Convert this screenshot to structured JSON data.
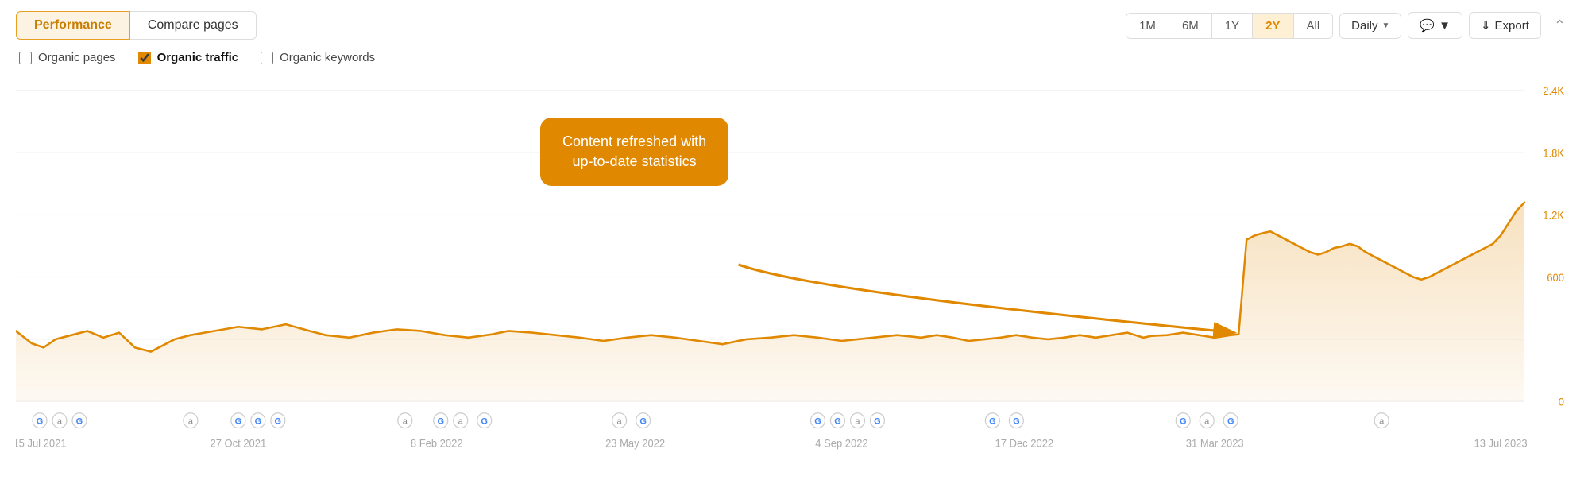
{
  "tabs": {
    "performance_label": "Performance",
    "compare_pages_label": "Compare pages"
  },
  "time_buttons": [
    "1M",
    "6M",
    "1Y",
    "2Y",
    "All"
  ],
  "active_time": "2Y",
  "daily_label": "Daily",
  "export_label": "Export",
  "checkboxes": [
    {
      "id": "organic-pages",
      "label": "Organic pages",
      "checked": false
    },
    {
      "id": "organic-traffic",
      "label": "Organic traffic",
      "checked": true
    },
    {
      "id": "organic-keywords",
      "label": "Organic keywords",
      "checked": false
    }
  ],
  "tooltip": {
    "line1": "Content refreshed with",
    "line2": "up-to-date statistics"
  },
  "y_axis": {
    "labels": [
      "2.4K",
      "1.8K",
      "1.2K",
      "600",
      "0"
    ]
  },
  "x_axis": {
    "labels": [
      "15 Jul 2021",
      "27 Oct 2021",
      "8 Feb 2022",
      "23 May 2022",
      "4 Sep 2022",
      "17 Dec 2022",
      "31 Mar 2023",
      "13 Jul 2023"
    ]
  },
  "annotation_icons": {
    "G": "G",
    "a": "a"
  },
  "colors": {
    "orange": "#e08800",
    "orange_light": "#fdf0d5",
    "orange_fill": "rgba(224,136,0,0.15)",
    "tab_active_bg": "#fdf3e3",
    "tab_active_border": "#e8a020"
  }
}
